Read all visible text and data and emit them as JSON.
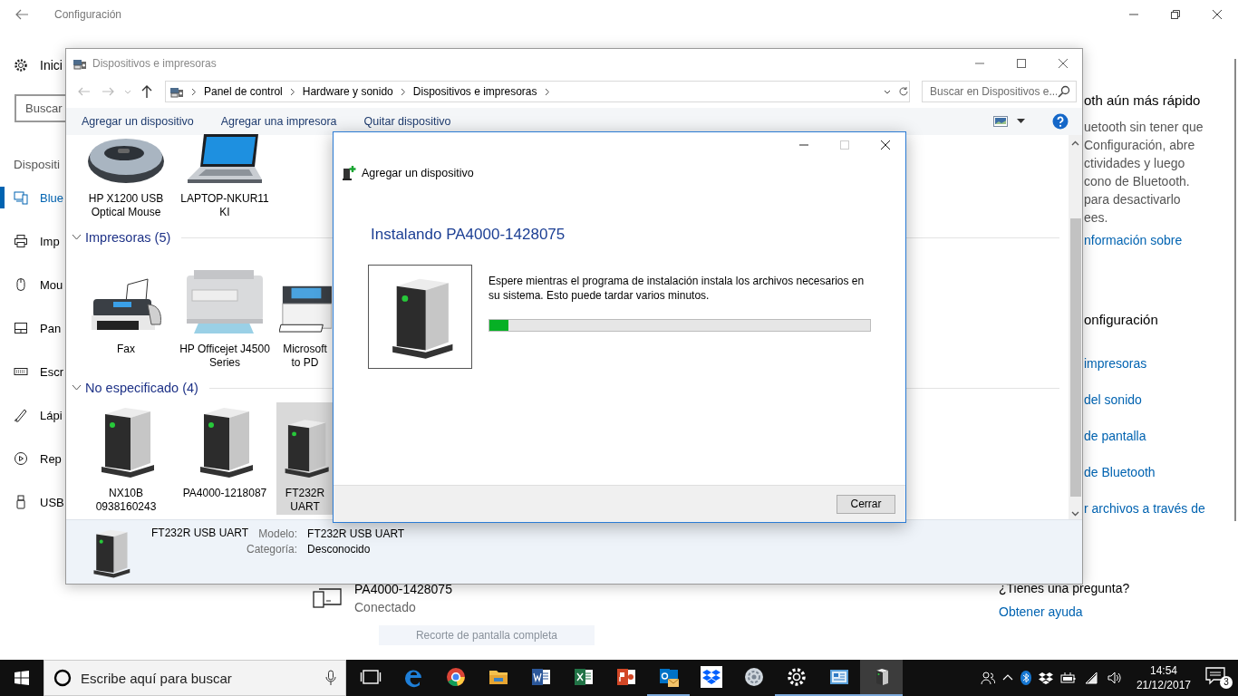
{
  "settings": {
    "title": "Configuración",
    "nav_home": "Inici",
    "search": {
      "placeholder": "Buscar"
    },
    "nav_heading": "Dispositi",
    "nav_items": [
      {
        "label": "Blue",
        "kind": "bluetooth",
        "selected": true
      },
      {
        "label": "Imp",
        "kind": "printer",
        "selected": false
      },
      {
        "label": "Mou",
        "kind": "mouse",
        "selected": false
      },
      {
        "label": "Pan",
        "kind": "touchpad",
        "selected": false
      },
      {
        "label": "Escr",
        "kind": "keyboard",
        "selected": false
      },
      {
        "label": "Lápi",
        "kind": "pen",
        "selected": false
      },
      {
        "label": "Rep",
        "kind": "autoplay",
        "selected": false
      },
      {
        "label": "USB",
        "kind": "usb",
        "selected": false
      }
    ],
    "side_panel": [
      {
        "kind": "heading",
        "text": "oth aún más rápido"
      },
      {
        "kind": "text",
        "text": "uetooth sin tener que"
      },
      {
        "kind": "text",
        "text": "Configuración, abre"
      },
      {
        "kind": "text",
        "text": "ctividades y luego"
      },
      {
        "kind": "text",
        "text": "cono de Bluetooth."
      },
      {
        "kind": "text",
        "text": "para desactivarlo"
      },
      {
        "kind": "text",
        "text": "ees."
      },
      {
        "kind": "link",
        "text": "nformación sobre"
      },
      {
        "kind": "heading",
        "text": "onfiguración"
      },
      {
        "kind": "link",
        "text": "impresoras"
      },
      {
        "kind": "link",
        "text": "del sonido"
      },
      {
        "kind": "link",
        "text": "de pantalla"
      },
      {
        "kind": "link",
        "text": "de Bluetooth"
      },
      {
        "kind": "link",
        "text": "r archivos a través de"
      }
    ],
    "device": {
      "name": "PA4000-1428075",
      "status": "Conectado"
    },
    "help": {
      "question": "¿Tienes una pregunta?",
      "link": "Obtener ayuda"
    },
    "tooltip": "Recorte de pantalla completa"
  },
  "explorer": {
    "title": "Dispositivos e impresoras",
    "breadcrumbs": [
      "Panel de control",
      "Hardware y sonido",
      "Dispositivos e impresoras"
    ],
    "search": {
      "placeholder": "Buscar en Dispositivos e..."
    },
    "commands": [
      "Agregar un dispositivo",
      "Agregar una impresora",
      "Quitar dispositivo"
    ],
    "groups": [
      {
        "devices": [
          {
            "label": "HP X1200 USB Optical Mouse",
            "kind": "mouse",
            "selected": false
          },
          {
            "label": "LAPTOP-NKUR11KI",
            "kind": "laptop",
            "selected": false
          }
        ]
      },
      {
        "header": "Impresoras (5)",
        "expanded": true,
        "devices": [
          {
            "label": "Fax",
            "kind": "fax",
            "selected": false
          },
          {
            "label": "HP Officejet J4500 Series",
            "kind": "printer",
            "selected": false
          },
          {
            "label": "Microsoft to PD",
            "kind": "pdf-printer",
            "selected": false
          }
        ]
      },
      {
        "header": "No especificado (4)",
        "expanded": true,
        "devices": [
          {
            "label": "NX10B 0938160243",
            "kind": "tower",
            "selected": false
          },
          {
            "label": "PA4000-1218087",
            "kind": "tower",
            "selected": false
          },
          {
            "label": "FT232R UART",
            "kind": "tower",
            "selected": true
          }
        ]
      }
    ],
    "details": {
      "name": "FT232R USB UART",
      "fields": [
        {
          "label": "Modelo:",
          "value": "FT232R USB UART"
        },
        {
          "label": "Categoría:",
          "value": "Desconocido"
        }
      ]
    }
  },
  "dialog": {
    "title": "Agregar un dispositivo",
    "heading": "Instalando PA4000-1428075",
    "message": "Espere mientras el programa de instalación instala los archivos necesarios en su sistema. Esto puede tardar varios minutos.",
    "progress": {
      "level": 0.05
    },
    "buttons": [
      "Cerrar"
    ]
  },
  "taskbar": {
    "search": {
      "placeholder": "Escribe aquí para buscar"
    },
    "apps": [
      {
        "kind": "taskview",
        "running": false,
        "active": false
      },
      {
        "kind": "edge",
        "running": false,
        "active": false
      },
      {
        "kind": "chrome",
        "running": false,
        "active": false
      },
      {
        "kind": "folder",
        "running": false,
        "active": false
      },
      {
        "kind": "word",
        "running": false,
        "active": false
      },
      {
        "kind": "excel",
        "running": false,
        "active": false
      },
      {
        "kind": "powerpoint",
        "running": false,
        "active": false
      },
      {
        "kind": "outlook",
        "running": true,
        "active": false
      },
      {
        "kind": "dropbox",
        "running": false,
        "active": false
      },
      {
        "kind": "network",
        "running": false,
        "active": false
      },
      {
        "kind": "settings",
        "running": true,
        "active": false
      },
      {
        "kind": "control",
        "running": true,
        "active": false
      },
      {
        "kind": "device",
        "running": true,
        "active": true
      }
    ],
    "time": "14:54",
    "date": "21/12/2017",
    "notifications": "3"
  }
}
